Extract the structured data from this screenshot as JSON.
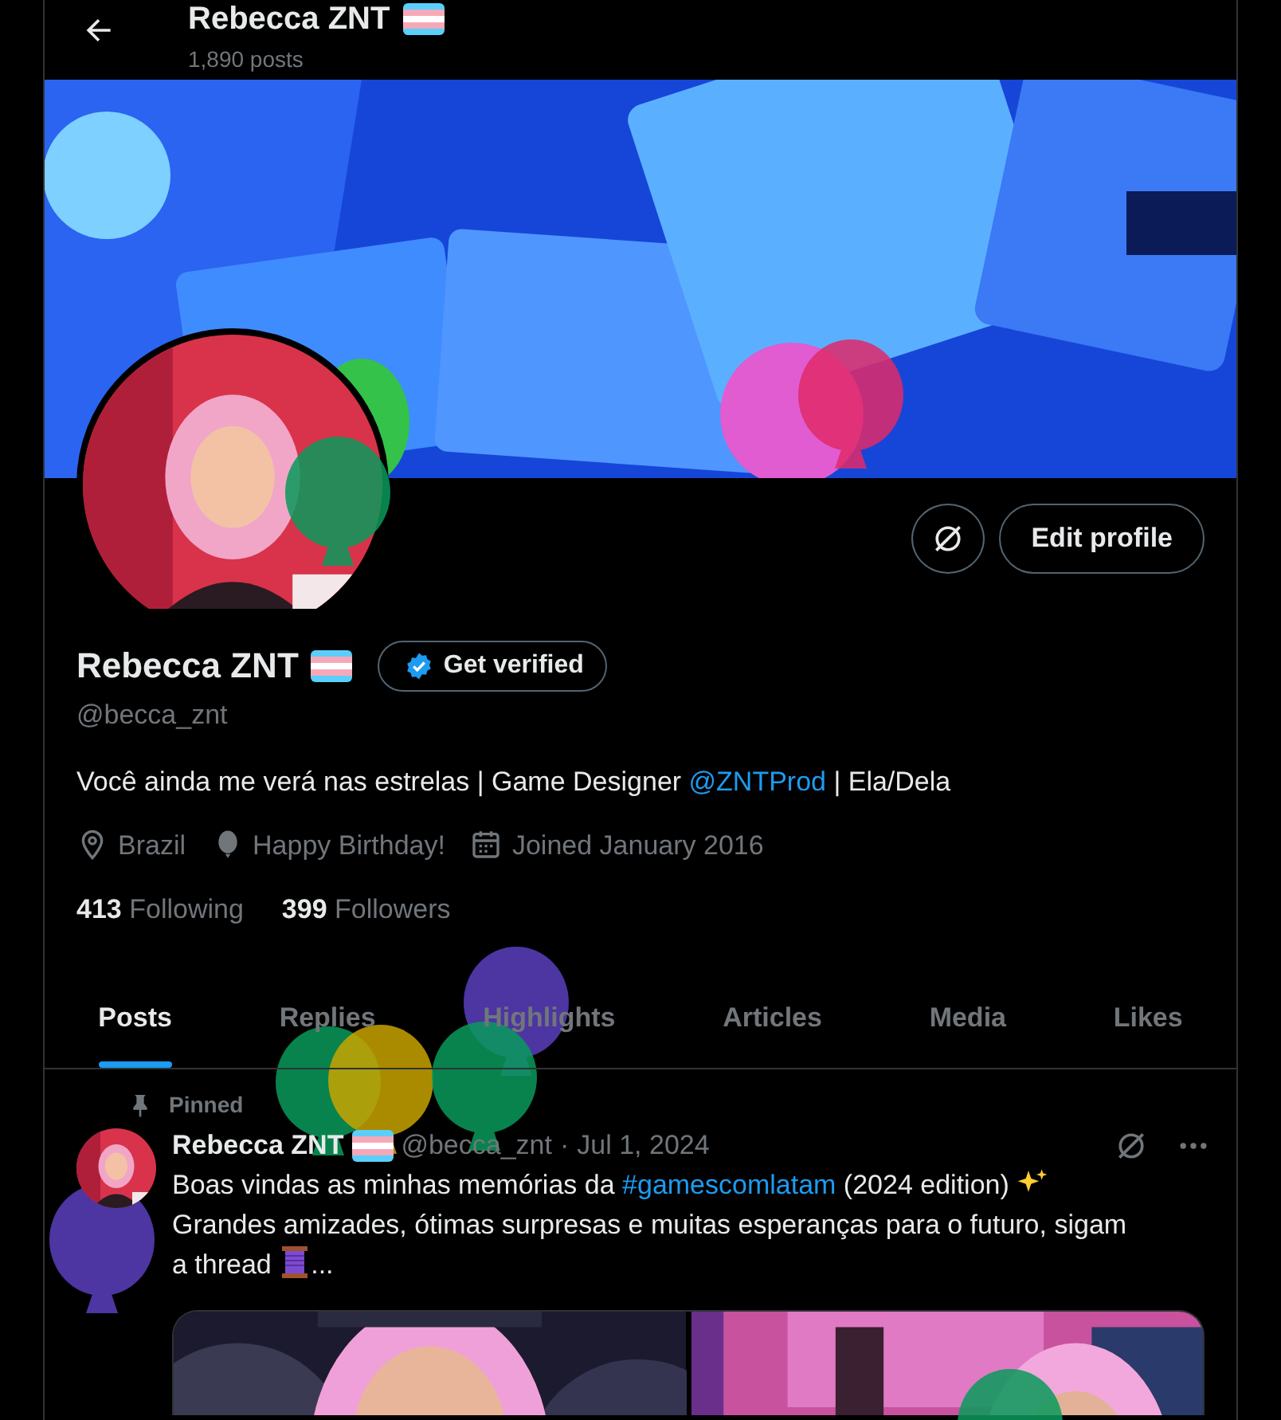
{
  "header": {
    "title": "Rebecca ZNT",
    "subtitle": "1,890 posts"
  },
  "actions": {
    "edit_label": "Edit profile"
  },
  "profile": {
    "name": "Rebecca ZNT",
    "verify_label": "Get verified",
    "handle": "@becca_znt",
    "bio": [
      {
        "kind": "text",
        "text": "Você ainda me verá nas estrelas | Game Designer "
      },
      {
        "kind": "link",
        "text": "@ZNTProd"
      },
      {
        "kind": "text",
        "text": " | Ela/Dela"
      }
    ],
    "meta": [
      {
        "kind": "location",
        "text": "Brazil"
      },
      {
        "kind": "birthday",
        "text": "Happy Birthday!"
      },
      {
        "kind": "joined",
        "text": "Joined January 2016"
      }
    ],
    "stats": [
      {
        "count": "413",
        "label": "Following"
      },
      {
        "count": "399",
        "label": "Followers"
      }
    ]
  },
  "tabs": [
    {
      "label": "Posts",
      "selected": true
    },
    {
      "label": "Replies",
      "selected": false
    },
    {
      "label": "Highlights",
      "selected": false
    },
    {
      "label": "Articles",
      "selected": false
    },
    {
      "label": "Media",
      "selected": false
    },
    {
      "label": "Likes",
      "selected": false
    }
  ],
  "post": {
    "pinned_label": "Pinned",
    "author": "Rebecca ZNT",
    "handle": "@becca_znt",
    "separator": "·",
    "date": "Jul 1, 2024",
    "text": [
      {
        "kind": "text",
        "text": "Boas vindas as minhas memórias da "
      },
      {
        "kind": "hashtag",
        "text": "#gamescomlatam"
      },
      {
        "kind": "text",
        "text": " (2024 edition) "
      },
      {
        "kind": "sparkles"
      },
      {
        "kind": "text",
        "text": " Grandes amizades, ótimas surpresas e muitas esperanças para o futuro, sigam a thread "
      },
      {
        "kind": "thread"
      },
      {
        "kind": "text",
        "text": "..."
      }
    ]
  }
}
